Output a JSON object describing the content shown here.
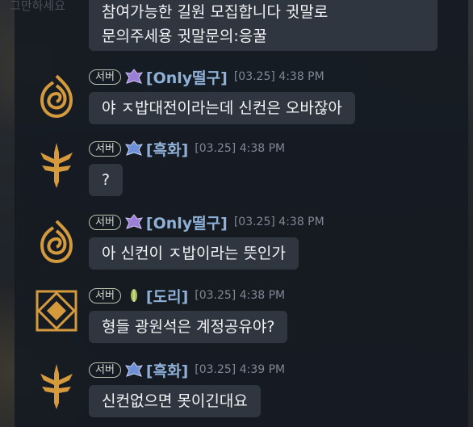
{
  "top_hint": "그만하세요",
  "top_message": {
    "line1": "참여가능한 길원 모집합니다 귓말로",
    "line2": "문의주세용 귓말문의:응꿀"
  },
  "server_badge": "서버",
  "messages": [
    {
      "name": "[Only떨구]",
      "time": "[03.25] 4:38 PM",
      "text": "야 ㅈ밥대전이라는데 신컨은 오바잖아",
      "avatar": "orange-swirl-emblem-icon",
      "rank": "purple-crest-icon"
    },
    {
      "name": "[흑화]",
      "time": "[03.25] 4:38 PM",
      "text": "?",
      "avatar": "winged-sword-emblem-icon",
      "rank": "blue-crest-icon"
    },
    {
      "name": "[Only떨구]",
      "time": "[03.25] 4:38 PM",
      "text": "아 신컨이 ㅈ밥이라는 뜻인가",
      "avatar": "orange-swirl-emblem-icon",
      "rank": "purple-crest-icon"
    },
    {
      "name": "[도리]",
      "time": "[03.25] 4:38 PM",
      "text": "형들 광원석은 계정공유야?",
      "avatar": "diamond-emblem-icon",
      "rank": "green-leaf-icon"
    },
    {
      "name": "[흑화]",
      "time": "[03.25] 4:39 PM",
      "text": "신컨없으면 못이긴대요",
      "avatar": "winged-sword-emblem-icon",
      "rank": "blue-crest-icon"
    }
  ],
  "colors": {
    "name": "#8fb1d8",
    "bubble": "#303640",
    "gold": "#d59a3c"
  }
}
